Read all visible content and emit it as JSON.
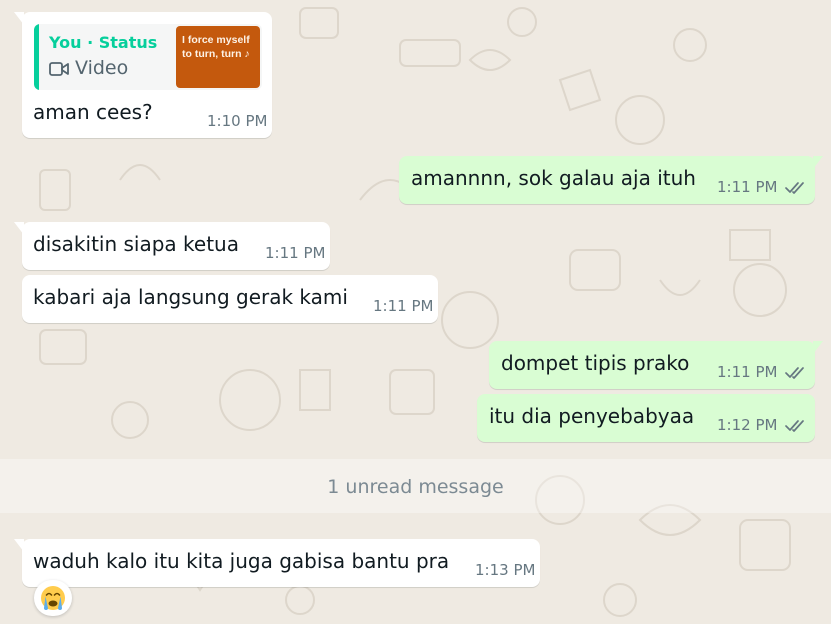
{
  "messages": [
    {
      "direction": "in",
      "text": "aman cees?",
      "time": "1:10 PM",
      "reply": {
        "author": "You · Status",
        "type": "Video",
        "thumb_text": "I force myself to turn, turn ♪"
      }
    },
    {
      "direction": "out",
      "text": "amannnn, sok galau aja ituh",
      "time": "1:11 PM",
      "status": "read"
    },
    {
      "direction": "in",
      "text": "disakitin siapa ketua",
      "time": "1:11 PM"
    },
    {
      "direction": "in",
      "text": "kabari aja langsung gerak kami",
      "time": "1:11 PM"
    },
    {
      "direction": "out",
      "text": "dompet tipis prako",
      "time": "1:11 PM",
      "status": "read"
    },
    {
      "direction": "out",
      "text": "itu dia penyebabyaa",
      "time": "1:12 PM",
      "status": "read"
    },
    {
      "direction": "in",
      "text": "waduh kalo itu kita juga gabisa bantu pra",
      "time": "1:13 PM",
      "reaction": "loudly-crying-face-emoji"
    }
  ],
  "unread_divider": "1 unread message",
  "colors": {
    "background": "#efeae2",
    "incoming": "#ffffff",
    "outgoing": "#d9fdd3",
    "accent": "#06cf9c",
    "time": "#667781",
    "thumb": "#c4590d"
  }
}
